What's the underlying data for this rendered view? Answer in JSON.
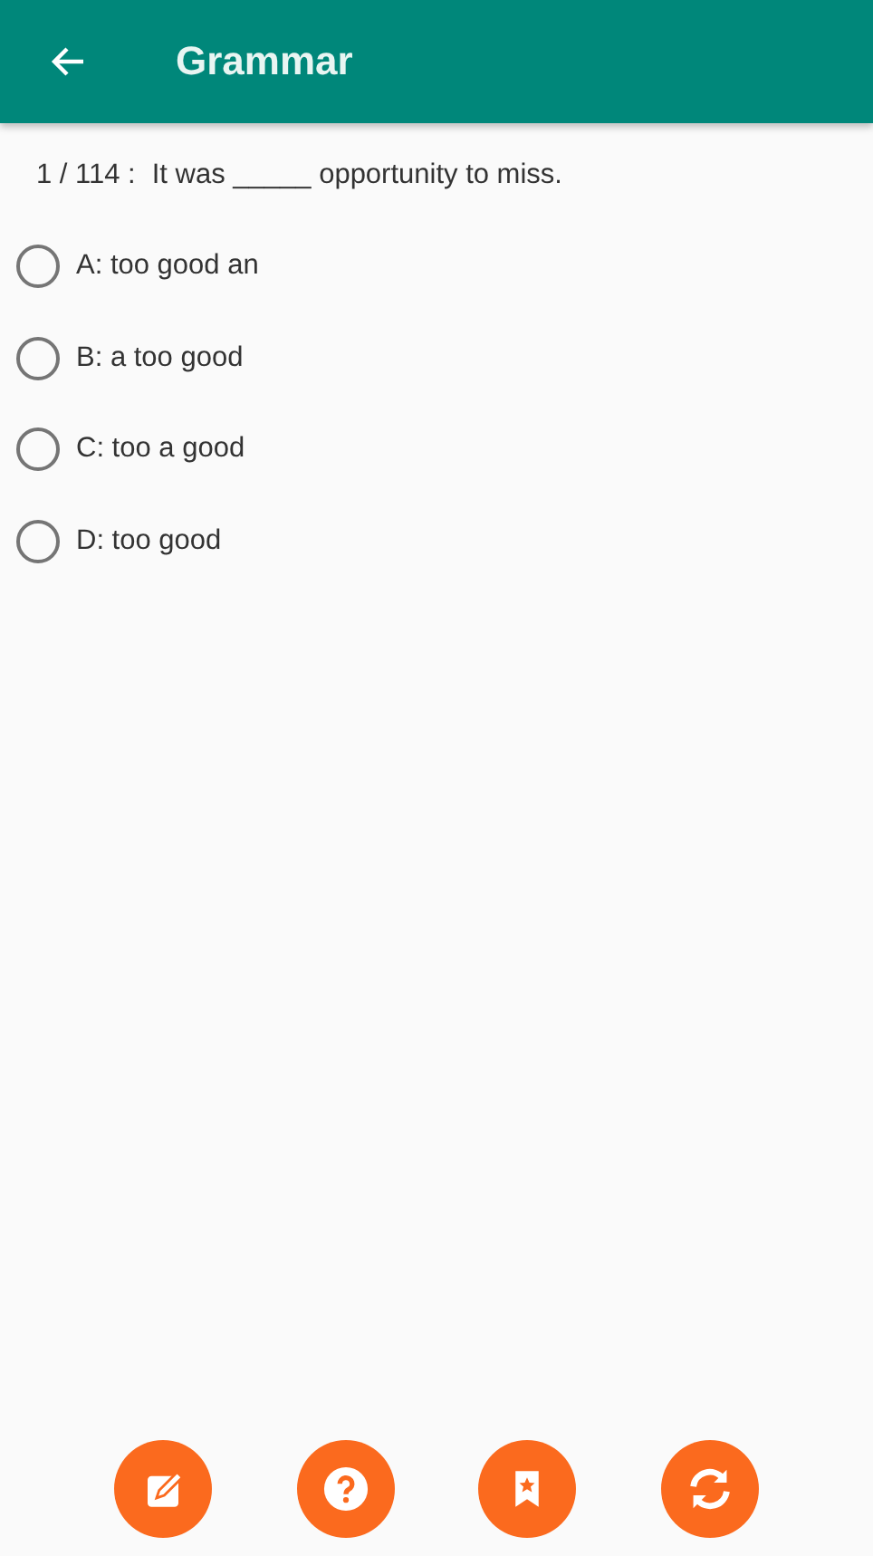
{
  "app_bar": {
    "title": "Grammar"
  },
  "question": {
    "counter": "1 / 114 :",
    "text": "It was _____ opportunity to miss."
  },
  "options": [
    {
      "label": "A: too good an",
      "selected": false
    },
    {
      "label": "B: a too good",
      "selected": false
    },
    {
      "label": "C: too a good",
      "selected": false
    },
    {
      "label": "D: too good",
      "selected": false
    }
  ],
  "actions": [
    {
      "kind": "edit"
    },
    {
      "kind": "help"
    },
    {
      "kind": "bookmark"
    },
    {
      "kind": "refresh"
    }
  ]
}
